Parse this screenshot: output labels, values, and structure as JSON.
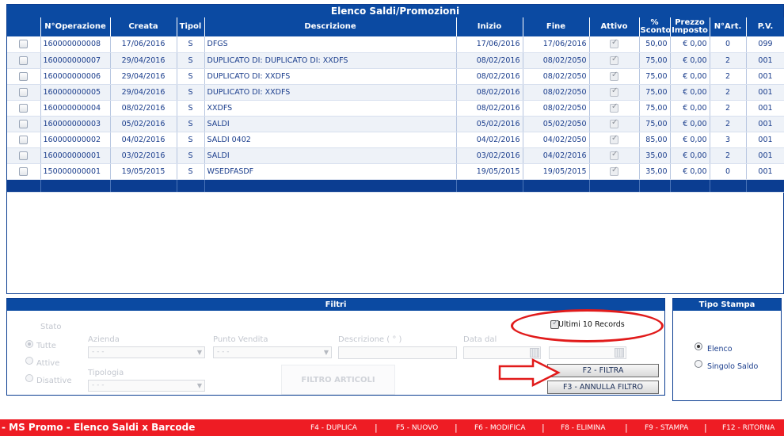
{
  "list": {
    "title": "Elenco Saldi/Promozioni",
    "headers": {
      "num_operazione": "N°Operazione",
      "creata": "Creata",
      "tipo": "Tipol",
      "descrizione": "Descrizione",
      "inizio": "Inizio",
      "fine": "Fine",
      "attivo": "Attivo",
      "sconto": "% Sconto",
      "prezzo_imposto": "Prezzo Imposto",
      "num_art": "N°Art.",
      "pv": "P.V."
    },
    "rows": [
      {
        "num": "160000000008",
        "creata": "17/06/2016",
        "tipo": "S",
        "descrizione": "DFGS",
        "inizio": "17/06/2016",
        "fine": "17/06/2016",
        "attivo": true,
        "sconto": "50,00",
        "prezzo": "€ 0,00",
        "art": "0",
        "pv": "099"
      },
      {
        "num": "160000000007",
        "creata": "29/04/2016",
        "tipo": "S",
        "descrizione": "DUPLICATO DI: DUPLICATO DI: XXDFS",
        "inizio": "08/02/2016",
        "fine": "08/02/2050",
        "attivo": true,
        "sconto": "75,00",
        "prezzo": "€ 0,00",
        "art": "2",
        "pv": "001"
      },
      {
        "num": "160000000006",
        "creata": "29/04/2016",
        "tipo": "S",
        "descrizione": "DUPLICATO DI: XXDFS",
        "inizio": "08/02/2016",
        "fine": "08/02/2050",
        "attivo": true,
        "sconto": "75,00",
        "prezzo": "€ 0,00",
        "art": "2",
        "pv": "001"
      },
      {
        "num": "160000000005",
        "creata": "29/04/2016",
        "tipo": "S",
        "descrizione": "DUPLICATO DI: XXDFS",
        "inizio": "08/02/2016",
        "fine": "08/02/2050",
        "attivo": true,
        "sconto": "75,00",
        "prezzo": "€ 0,00",
        "art": "2",
        "pv": "001"
      },
      {
        "num": "160000000004",
        "creata": "08/02/2016",
        "tipo": "S",
        "descrizione": "XXDFS",
        "inizio": "08/02/2016",
        "fine": "08/02/2050",
        "attivo": true,
        "sconto": "75,00",
        "prezzo": "€ 0,00",
        "art": "2",
        "pv": "001"
      },
      {
        "num": "160000000003",
        "creata": "05/02/2016",
        "tipo": "S",
        "descrizione": "SALDI",
        "inizio": "05/02/2016",
        "fine": "05/02/2050",
        "attivo": true,
        "sconto": "75,00",
        "prezzo": "€ 0,00",
        "art": "2",
        "pv": "001"
      },
      {
        "num": "160000000002",
        "creata": "04/02/2016",
        "tipo": "S",
        "descrizione": "SALDI 0402",
        "inizio": "04/02/2016",
        "fine": "04/02/2050",
        "attivo": true,
        "sconto": "85,00",
        "prezzo": "€ 0,00",
        "art": "3",
        "pv": "001"
      },
      {
        "num": "160000000001",
        "creata": "03/02/2016",
        "tipo": "S",
        "descrizione": "SALDI",
        "inizio": "03/02/2016",
        "fine": "04/02/2016",
        "attivo": true,
        "sconto": "35,00",
        "prezzo": "€ 0,00",
        "art": "2",
        "pv": "001"
      },
      {
        "num": "150000000001",
        "creata": "19/05/2015",
        "tipo": "S",
        "descrizione": "WSEDFASDF",
        "inizio": "19/05/2015",
        "fine": "19/05/2015",
        "attivo": true,
        "sconto": "35,00",
        "prezzo": "€ 0,00",
        "art": "0",
        "pv": "001"
      }
    ]
  },
  "filters": {
    "title": "Filtri",
    "stato_label": "Stato",
    "stato_options": [
      "Tutte",
      "Attive",
      "Disattive"
    ],
    "azienda_label": "Azienda",
    "azienda_value": "- - -",
    "punto_vendita_label": "Punto Vendita",
    "punto_vendita_value": "- - -",
    "descrizione_label": "Descrizione ( ° )",
    "data_dal_label": "Data dal",
    "tipologia_label": "Tipologia",
    "tipologia_value": "- - -",
    "filtro_articoli": "FILTRO ARTICOLI",
    "ultimi_label": "Ultimi 10 Records",
    "ultimi_checked": true,
    "filtra_button": "F2 - FILTRA",
    "annulla_button": "F3 - ANNULLA FILTRO"
  },
  "tipo_stampa": {
    "title": "Tipo Stampa",
    "options": [
      "Elenco",
      "Singolo Saldo"
    ],
    "selected": "Elenco"
  },
  "bottom_bar": {
    "title": "- MS Promo - Elenco Saldi x Barcode",
    "keys": [
      "F4 - DUPLICA",
      "F5 - NUOVO",
      "F6 - MODIFICA",
      "F8 - ELIMINA",
      "F9 - STAMPA",
      "F12 - RITORNA"
    ],
    "separator": "|"
  },
  "colors": {
    "header_blue": "#0b4aa2",
    "dark_blue": "#0b3d91",
    "text_blue": "#1a3d8c",
    "bar_red": "#ee1c24",
    "annotation_red": "#e11b1b"
  },
  "icons": [
    "checkbox-icon",
    "calendar-icon",
    "dropdown-arrow-icon",
    "radio-icon"
  ]
}
